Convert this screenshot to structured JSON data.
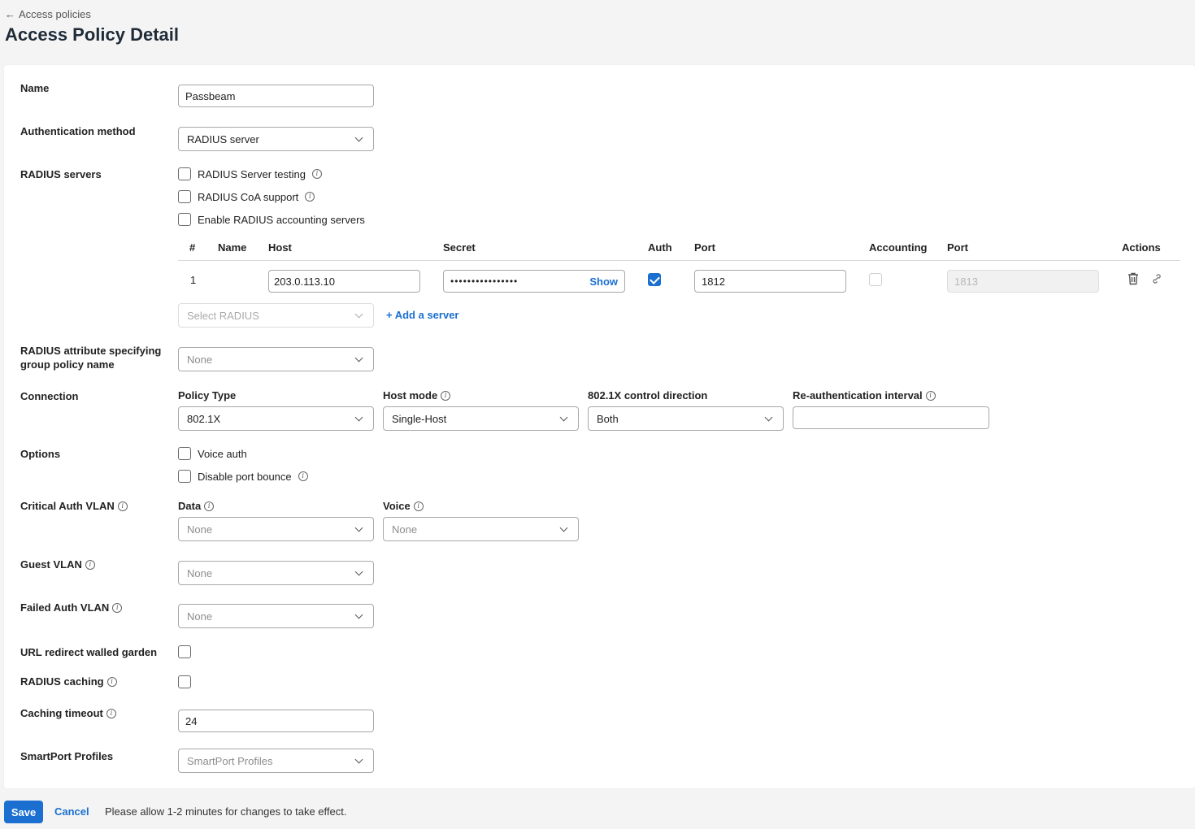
{
  "header": {
    "back_link": "Access policies",
    "title": "Access Policy Detail"
  },
  "form": {
    "name": {
      "label": "Name",
      "value": "Passbeam"
    },
    "auth_method": {
      "label": "Authentication method",
      "value": "RADIUS server"
    },
    "radius_servers": {
      "label": "RADIUS servers",
      "options": [
        {
          "label": "RADIUS Server testing",
          "checked": false,
          "info": true
        },
        {
          "label": "RADIUS CoA support",
          "checked": false,
          "info": true
        },
        {
          "label": "Enable RADIUS accounting servers",
          "checked": false,
          "info": false
        }
      ],
      "table": {
        "headers": {
          "num": "#",
          "name": "Name",
          "host": "Host",
          "secret": "Secret",
          "auth": "Auth",
          "port": "Port",
          "accounting": "Accounting",
          "acct_port": "Port",
          "actions": "Actions"
        },
        "rows": [
          {
            "num": "1",
            "name": "",
            "host": "203.0.113.10",
            "secret": "••••••••••••••••",
            "show": "Show",
            "auth": true,
            "port": "1812",
            "accounting": false,
            "acct_port": "1813"
          }
        ]
      },
      "select_placeholder": "Select RADIUS",
      "add_server": "+ Add a server"
    },
    "radius_attr": {
      "label": "RADIUS attribute specifying group policy name",
      "value": "None"
    },
    "connection": {
      "label": "Connection",
      "policy_type": {
        "label": "Policy Type",
        "value": "802.1X"
      },
      "host_mode": {
        "label": "Host mode",
        "value": "Single-Host"
      },
      "control_direction": {
        "label": "802.1X control direction",
        "value": "Both"
      },
      "reauth_interval": {
        "label": "Re-authentication interval",
        "value": ""
      }
    },
    "options": {
      "label": "Options",
      "items": [
        {
          "label": "Voice auth",
          "checked": false
        },
        {
          "label": "Disable port bounce",
          "checked": false
        }
      ]
    },
    "critical_auth_vlan": {
      "label": "Critical Auth VLAN",
      "data": {
        "label": "Data",
        "value": "None"
      },
      "voice": {
        "label": "Voice",
        "value": "None"
      }
    },
    "guest_vlan": {
      "label": "Guest VLAN",
      "value": "None"
    },
    "failed_auth_vlan": {
      "label": "Failed Auth VLAN",
      "value": "None"
    },
    "url_redirect": {
      "label": "URL redirect walled garden",
      "checked": false
    },
    "radius_caching": {
      "label": "RADIUS caching",
      "checked": false
    },
    "caching_timeout": {
      "label": "Caching timeout",
      "value": "24"
    },
    "smartport": {
      "label": "SmartPort Profiles",
      "value": "SmartPort Profiles"
    }
  },
  "footer": {
    "save": "Save",
    "cancel": "Cancel",
    "note": "Please allow 1-2 minutes for changes to take effect."
  },
  "colors": {
    "accent": "#1b6fd1",
    "background": "#f4f4f4",
    "card": "#ffffff"
  }
}
